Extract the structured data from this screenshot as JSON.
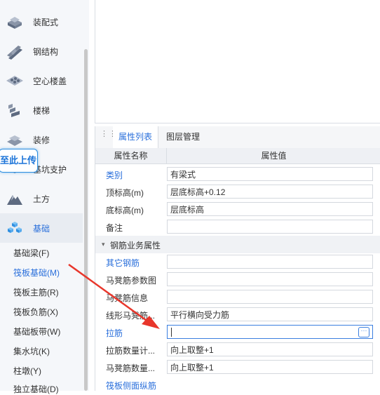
{
  "sidebar": {
    "nav_items": [
      {
        "label": "装配式",
        "icon": "prefab-icon"
      },
      {
        "label": "钢结构",
        "icon": "steel-beam-icon"
      },
      {
        "label": "空心楼盖",
        "icon": "hollow-slab-icon"
      },
      {
        "label": "楼梯",
        "icon": "stairs-icon"
      },
      {
        "label": "装修",
        "icon": "decoration-icon"
      },
      {
        "label": "基坑支护",
        "icon": "foundation-pit-icon"
      },
      {
        "label": "土方",
        "icon": "earthwork-icon"
      },
      {
        "label": "基础",
        "icon": "foundation-icon"
      }
    ],
    "sub_items": [
      "基础梁(F)",
      "筏板基础(M)",
      "筏板主筋(R)",
      "筏板负筋(X)",
      "基础板带(W)",
      "集水坑(K)",
      "柱墩(Y)",
      "独立基础(D)"
    ],
    "selected_sub_item": "筏板基础(M)",
    "upload_overlay_text": "至此上传"
  },
  "panel": {
    "tabs": [
      "属性列表",
      "图层管理"
    ],
    "active_tab": "属性列表",
    "columns": {
      "name": "属性名称",
      "value": "属性值"
    },
    "rows": [
      {
        "name": "类别",
        "value": "有梁式",
        "link": true
      },
      {
        "name": "顶标高(m)",
        "value": "层底标高+0.12",
        "link": false
      },
      {
        "name": "底标高(m)",
        "value": "层底标高",
        "link": false
      },
      {
        "name": "备注",
        "value": "",
        "link": false
      }
    ],
    "group": {
      "label": "钢筋业务属性",
      "collapsed": false
    },
    "group_rows": [
      {
        "name": "其它钢筋",
        "value": "",
        "link": true
      },
      {
        "name": "马凳筋参数图",
        "value": "",
        "link": false
      },
      {
        "name": "马凳筋信息",
        "value": "",
        "link": false
      },
      {
        "name": "线形马凳筋...",
        "value": "平行横向受力筋",
        "link": false
      },
      {
        "name": "拉筋",
        "value": "",
        "link": true,
        "active": true
      },
      {
        "name": "拉筋数量计...",
        "value": "向上取整+1",
        "link": false
      },
      {
        "name": "马凳筋数量...",
        "value": "向上取整+1",
        "link": false
      },
      {
        "name": "筏板侧面纵筋",
        "value": "",
        "link": true
      }
    ],
    "ellipsis_label": "···"
  },
  "colors": {
    "accent": "#2a6fdb",
    "arrow": "#e8362b"
  }
}
